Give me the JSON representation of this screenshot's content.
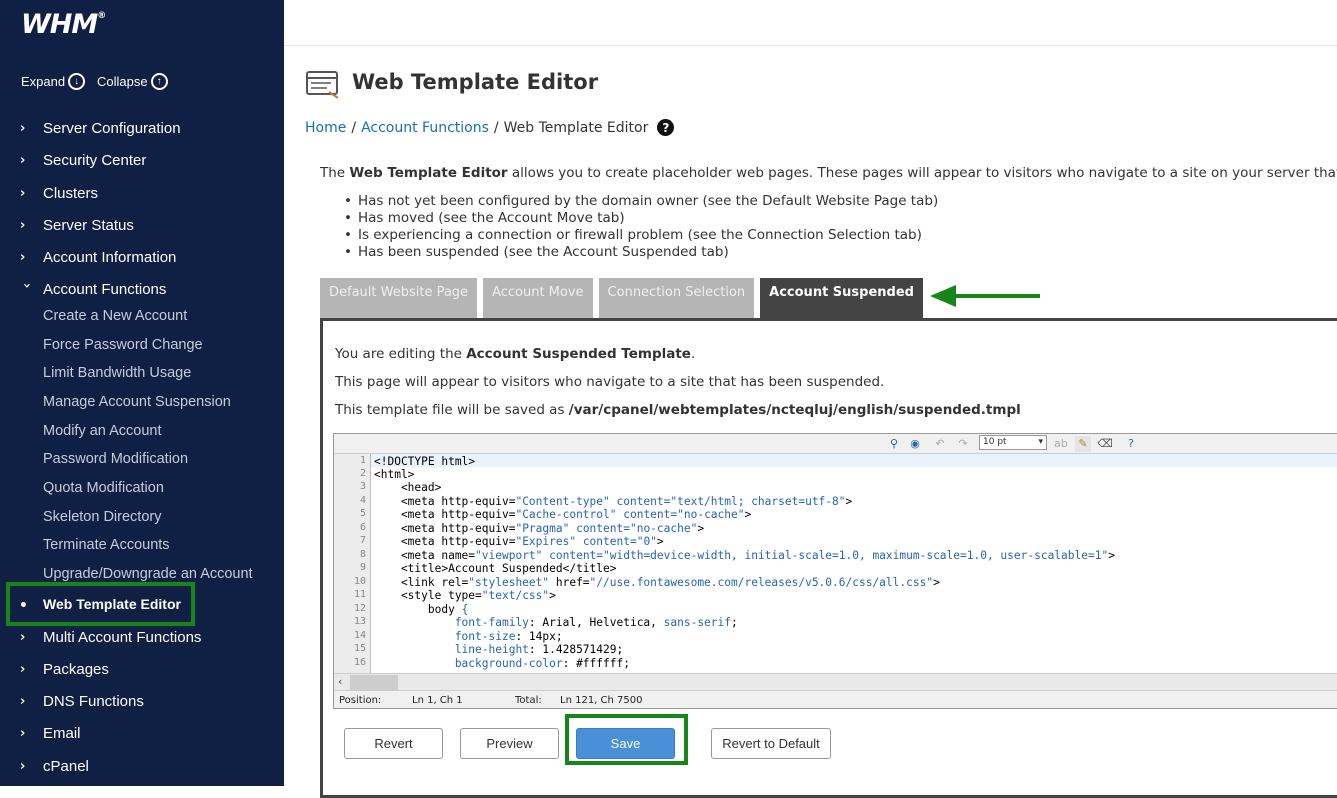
{
  "sidebar": {
    "logo": "WHM",
    "expand": "Expand",
    "collapse": "Collapse",
    "nav": [
      {
        "label": "Server Configuration"
      },
      {
        "label": "Security Center"
      },
      {
        "label": "Clusters"
      },
      {
        "label": "Server Status"
      },
      {
        "label": "Account Information"
      },
      {
        "label": "Account Functions"
      }
    ],
    "account_functions": [
      "Create a New Account",
      "Force Password Change",
      "Limit Bandwidth Usage",
      "Manage Account Suspension",
      "Modify an Account",
      "Password Modification",
      "Quota Modification",
      "Skeleton Directory",
      "Terminate Accounts",
      "Upgrade/Downgrade an Account",
      "Web Template Editor"
    ],
    "nav_bottom": [
      {
        "label": "Multi Account Functions"
      },
      {
        "label": "Packages"
      },
      {
        "label": "DNS Functions"
      },
      {
        "label": "Email"
      },
      {
        "label": "cPanel"
      }
    ]
  },
  "page": {
    "title": "Web Template Editor",
    "breadcrumb": [
      "Home",
      "Account Functions",
      "Web Template Editor"
    ],
    "intro_pre": "The ",
    "intro_bold": "Web Template Editor",
    "intro_post": " allows you to create placeholder web pages. These pages will appear to visitors who navigate to a site on your server that:",
    "bullets": [
      "Has not yet been configured by the domain owner (see the Default Website Page tab)",
      "Has moved (see the Account Move tab)",
      "Is experiencing a connection or firewall problem (see the Connection Selection tab)",
      "Has been suspended (see the Account Suspended tab)"
    ],
    "tabs": [
      "Default Website Page",
      "Account Move",
      "Connection Selection",
      "Account Suspended"
    ]
  },
  "panel": {
    "editing_pre": "You are editing the ",
    "editing_bold": "Account Suspended Template",
    "editing_post": ".",
    "appear": "This page will appear to visitors who navigate to a site that has been suspended.",
    "saved_pre": "This template file will be saved as ",
    "saved_path": "/var/cpanel/webtemplates/ncteqluj/english/suspended.tmpl"
  },
  "editor": {
    "font_size": "10 pt",
    "line_numbers": [
      "1",
      "2",
      "3",
      "4",
      "5",
      "6",
      "7",
      "8",
      "9",
      "10",
      "11",
      "12",
      "13",
      "14",
      "15",
      "16"
    ],
    "status_position_label": "Position:",
    "status_position_value": "Ln 1, Ch 1",
    "status_total_label": "Total:",
    "status_total_value": "Ln 121, Ch 7500"
  },
  "buttons": {
    "revert": "Revert",
    "preview": "Preview",
    "save": "Save",
    "revert_default": "Revert to Default"
  },
  "colors": {
    "sidebar_bg": "#0f2044",
    "highlight_green": "#17851a",
    "link": "#1a6fb5",
    "save_button": "#4a90d9",
    "code_string": "#2a62b8"
  }
}
